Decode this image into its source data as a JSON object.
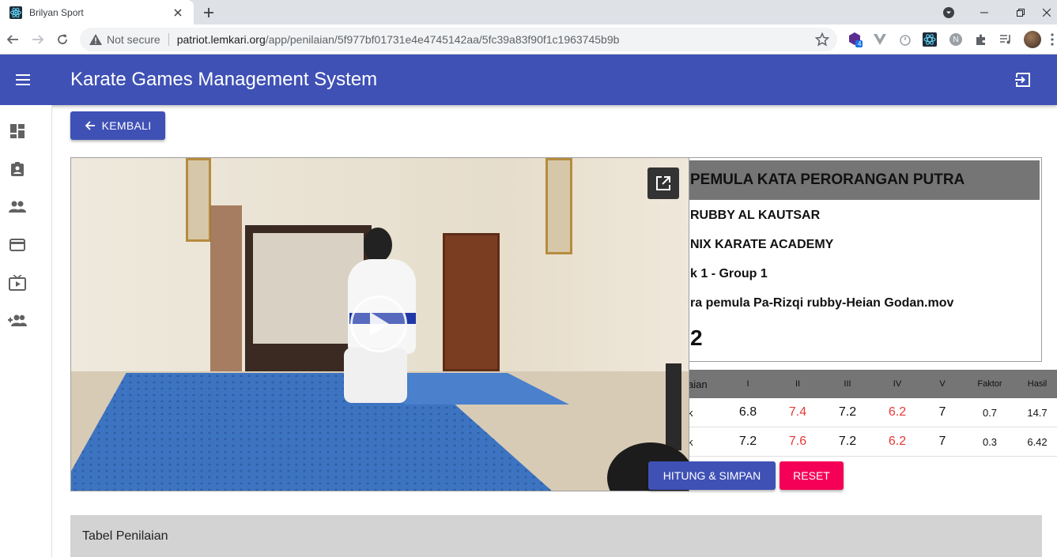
{
  "browser": {
    "tab_title": "Brilyan Sport",
    "security_label": "Not secure",
    "url_host": "patriot.lemkari.org",
    "url_path": "/app/penilaian/5f977bf01731e4e4745142aa/5fc39a83f90f1c1963745b9b",
    "extension_badge": "4",
    "extension_letter": "N"
  },
  "app": {
    "title": "Karate Games Management System",
    "back_label": "KEMBALI"
  },
  "sidebar": {
    "items": [
      "dashboard-icon",
      "assignment-ind-icon",
      "people-icon",
      "card-icon",
      "live-tv-icon",
      "group-add-icon"
    ]
  },
  "info": {
    "category": "PEMULA KATA PERORANGAN PUTRA",
    "athlete": "RUBBY AL KAUTSAR",
    "club": "NIX KARATE ACADEMY",
    "pool": "k 1 - Group 1",
    "file": "ra pemula Pa-Rizqi rubby-Heian Godan.mov",
    "number": "2"
  },
  "score_table": {
    "headers": [
      "aian",
      "I",
      "II",
      "III",
      "IV",
      "V",
      "Faktor",
      "Hasil"
    ],
    "rows": [
      {
        "label": "k",
        "i": "6.8",
        "ii": "7.4",
        "iii": "7.2",
        "iv": "6.2",
        "v": "7",
        "faktor": "0.7",
        "hasil": "14.7"
      },
      {
        "label": "k",
        "i": "7.2",
        "ii": "7.6",
        "iii": "7.2",
        "iv": "6.2",
        "v": "7",
        "faktor": "0.3",
        "hasil": "6.42"
      }
    ]
  },
  "actions": {
    "calculate_label": "HITUNG & SIMPAN",
    "reset_label": "RESET"
  },
  "panel": {
    "title": "Tabel Penilaian"
  },
  "colors": {
    "primary": "#3f51b5",
    "accent": "#f50057",
    "highlight_score": "#e53935",
    "header_gray": "#757575"
  }
}
